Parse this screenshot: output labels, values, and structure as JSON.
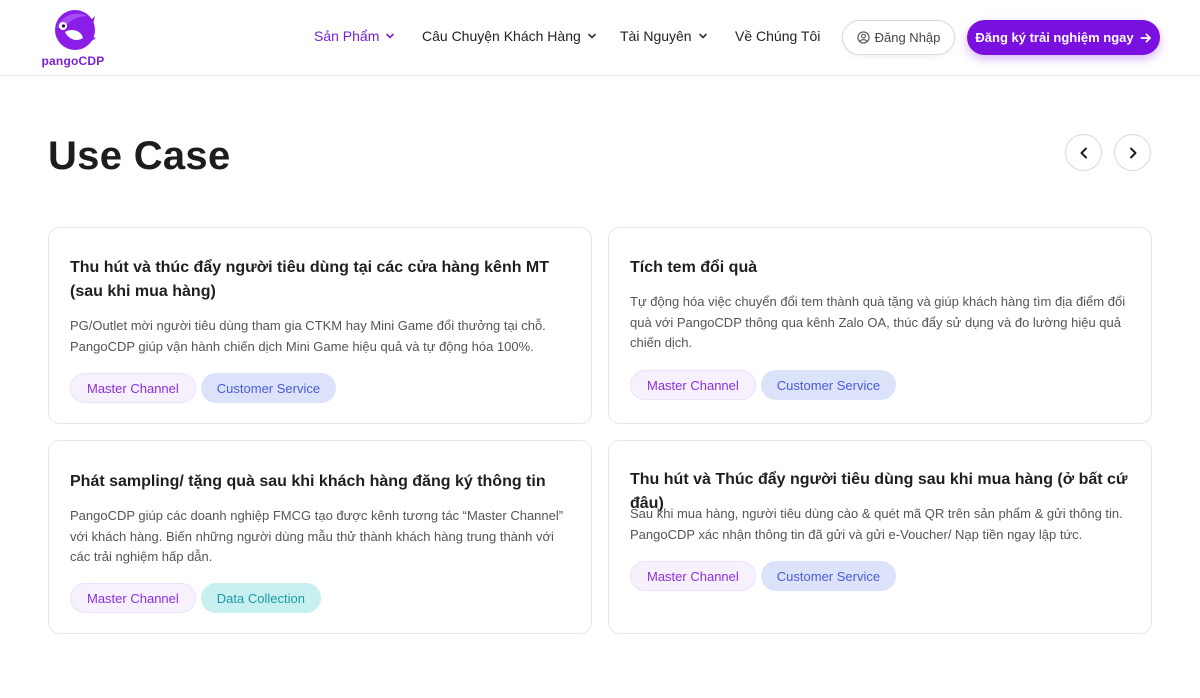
{
  "header": {
    "logo_text": "pangoCDP",
    "nav": [
      {
        "label": "Sản Phẩm",
        "active": true,
        "has_dropdown": true
      },
      {
        "label": "Câu Chuyện Khách Hàng",
        "active": false,
        "has_dropdown": true
      },
      {
        "label": "Tài Nguyên",
        "active": false,
        "has_dropdown": true
      },
      {
        "label": "Về Chúng Tôi",
        "active": false,
        "has_dropdown": false
      }
    ],
    "login_label": "Đăng Nhập",
    "signup_label": "Đăng ký trải nghiệm ngay"
  },
  "section": {
    "title": "Use Case"
  },
  "cards": [
    {
      "title": "Thu hút và thúc đẩy người tiêu dùng tại các cửa hàng kênh MT (sau khi mua hàng)",
      "description": "PG/Outlet mời người tiêu dùng tham gia CTKM hay Mini Game đổi thưởng tại chỗ. PangoCDP giúp vận hành chiến dịch Mini Game hiệu quả và tự động hóa 100%.",
      "tags": [
        "Master Channel",
        "Customer Service"
      ]
    },
    {
      "title": "Tích tem đổi quà",
      "description": "Tự động hóa việc chuyển đổi tem thành quà tặng và giúp khách hàng tìm địa điểm đổi quà với PangoCDP thông qua kênh Zalo OA, thúc đẩy sử dụng và đo lường hiệu quả chiến dịch.",
      "tags": [
        "Master Channel",
        "Customer Service"
      ]
    },
    {
      "title": "Phát sampling/ tặng quà sau khi khách hàng đăng ký thông tin",
      "description": "PangoCDP giúp các doanh nghiệp FMCG tạo được kênh tương tác “Master Channel” với khách hàng. Biến những người dùng mẫu thử thành khách hàng trung thành với các trải nghiệm hấp dẫn.",
      "tags": [
        "Master Channel",
        "Data Collection"
      ]
    },
    {
      "title": "Thu hút và Thúc đẩy người tiêu dùng sau khi mua hàng (ở bất cứ đâu)",
      "description": "Sau khi mua hàng, người tiêu dùng cào & quét mã QR trên sản phẩm & gửi thông tin. PangoCDP xác nhận thông tin đã gửi và gửi e-Voucher/ Nạp tiền ngay lập tức.",
      "tags": [
        "Master Channel",
        "Customer Service"
      ]
    }
  ],
  "colors": {
    "brand": "#7a10e0",
    "tag_master_bg": "#f7f1fd",
    "tag_service_bg": "#dde2fb",
    "tag_data_bg": "#c9f0f0"
  },
  "icons": {
    "user": "user-circle-icon",
    "arrow_right": "arrow-right-icon",
    "chevron": "chevron-down-icon",
    "prev": "chevron-left-icon",
    "next": "chevron-right-icon"
  }
}
